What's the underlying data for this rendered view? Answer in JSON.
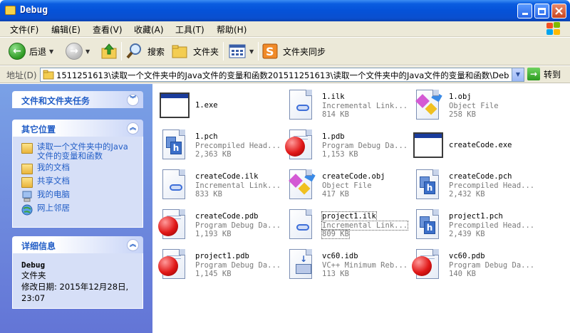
{
  "window": {
    "title": "Debug"
  },
  "menu": [
    "文件(F)",
    "编辑(E)",
    "查看(V)",
    "收藏(A)",
    "工具(T)",
    "帮助(H)"
  ],
  "toolbar": {
    "back": "后退",
    "search": "搜索",
    "folders": "文件夹",
    "sync": "文件夹同步"
  },
  "address": {
    "label": "地址(D)",
    "path": "1511251613\\读取一个文件夹中的Java文件的变量和函数201511251613\\读取一个文件夹中的Java文件的变量和函数\\Debug",
    "go": "转到"
  },
  "tasks": {
    "file_tasks_title": "文件和文件夹任务",
    "other_places_title": "其它位置",
    "other_places": [
      "读取一个文件夹中的Java文件的变量和函数",
      "我的文档",
      "共享文档",
      "我的电脑",
      "网上邻居"
    ],
    "details_title": "详细信息",
    "details_name": "Debug",
    "details_type": "文件夹",
    "details_modified": "修改日期: 2015年12月28日, 23:07"
  },
  "files": [
    {
      "name": "1.exe",
      "type": "",
      "size": "",
      "icon": "exe-window-icon"
    },
    {
      "name": "1.ilk",
      "type": "Incremental Link...",
      "size": "814 KB",
      "icon": "ilk-chain-icon"
    },
    {
      "name": "1.obj",
      "type": "Object File",
      "size": "258 KB",
      "icon": "obj-shapes-icon"
    },
    {
      "name": "1.pch",
      "type": "Precompiled Head...",
      "size": "2,363 KB",
      "icon": "pch-header-icon"
    },
    {
      "name": "1.pdb",
      "type": "Program Debug Da...",
      "size": "1,153 KB",
      "icon": "pdb-ball-icon"
    },
    {
      "name": "createCode.exe",
      "type": "",
      "size": "",
      "icon": "exe-window-icon"
    },
    {
      "name": "createCode.ilk",
      "type": "Incremental Link...",
      "size": "833 KB",
      "icon": "ilk-chain-icon"
    },
    {
      "name": "createCode.obj",
      "type": "Object File",
      "size": "417 KB",
      "icon": "obj-shapes-icon"
    },
    {
      "name": "createCode.pch",
      "type": "Precompiled Head...",
      "size": "2,432 KB",
      "icon": "pch-header-icon"
    },
    {
      "name": "createCode.pdb",
      "type": "Program Debug Da...",
      "size": "1,193 KB",
      "icon": "pdb-ball-icon"
    },
    {
      "name": "project1.ilk",
      "type": "Incremental Link...",
      "size": "809 KB",
      "icon": "ilk-chain-icon"
    },
    {
      "name": "project1.pch",
      "type": "Precompiled Head...",
      "size": "2,439 KB",
      "icon": "pch-header-icon"
    },
    {
      "name": "project1.pdb",
      "type": "Program Debug Da...",
      "size": "1,145 KB",
      "icon": "pdb-ball-icon"
    },
    {
      "name": "vc60.idb",
      "type": "VC++ Minimum Reb...",
      "size": "113 KB",
      "icon": "idb-keyboard-icon"
    },
    {
      "name": "vc60.pdb",
      "type": "Program Debug Da...",
      "size": "140 KB",
      "icon": "pdb-ball-icon"
    }
  ]
}
